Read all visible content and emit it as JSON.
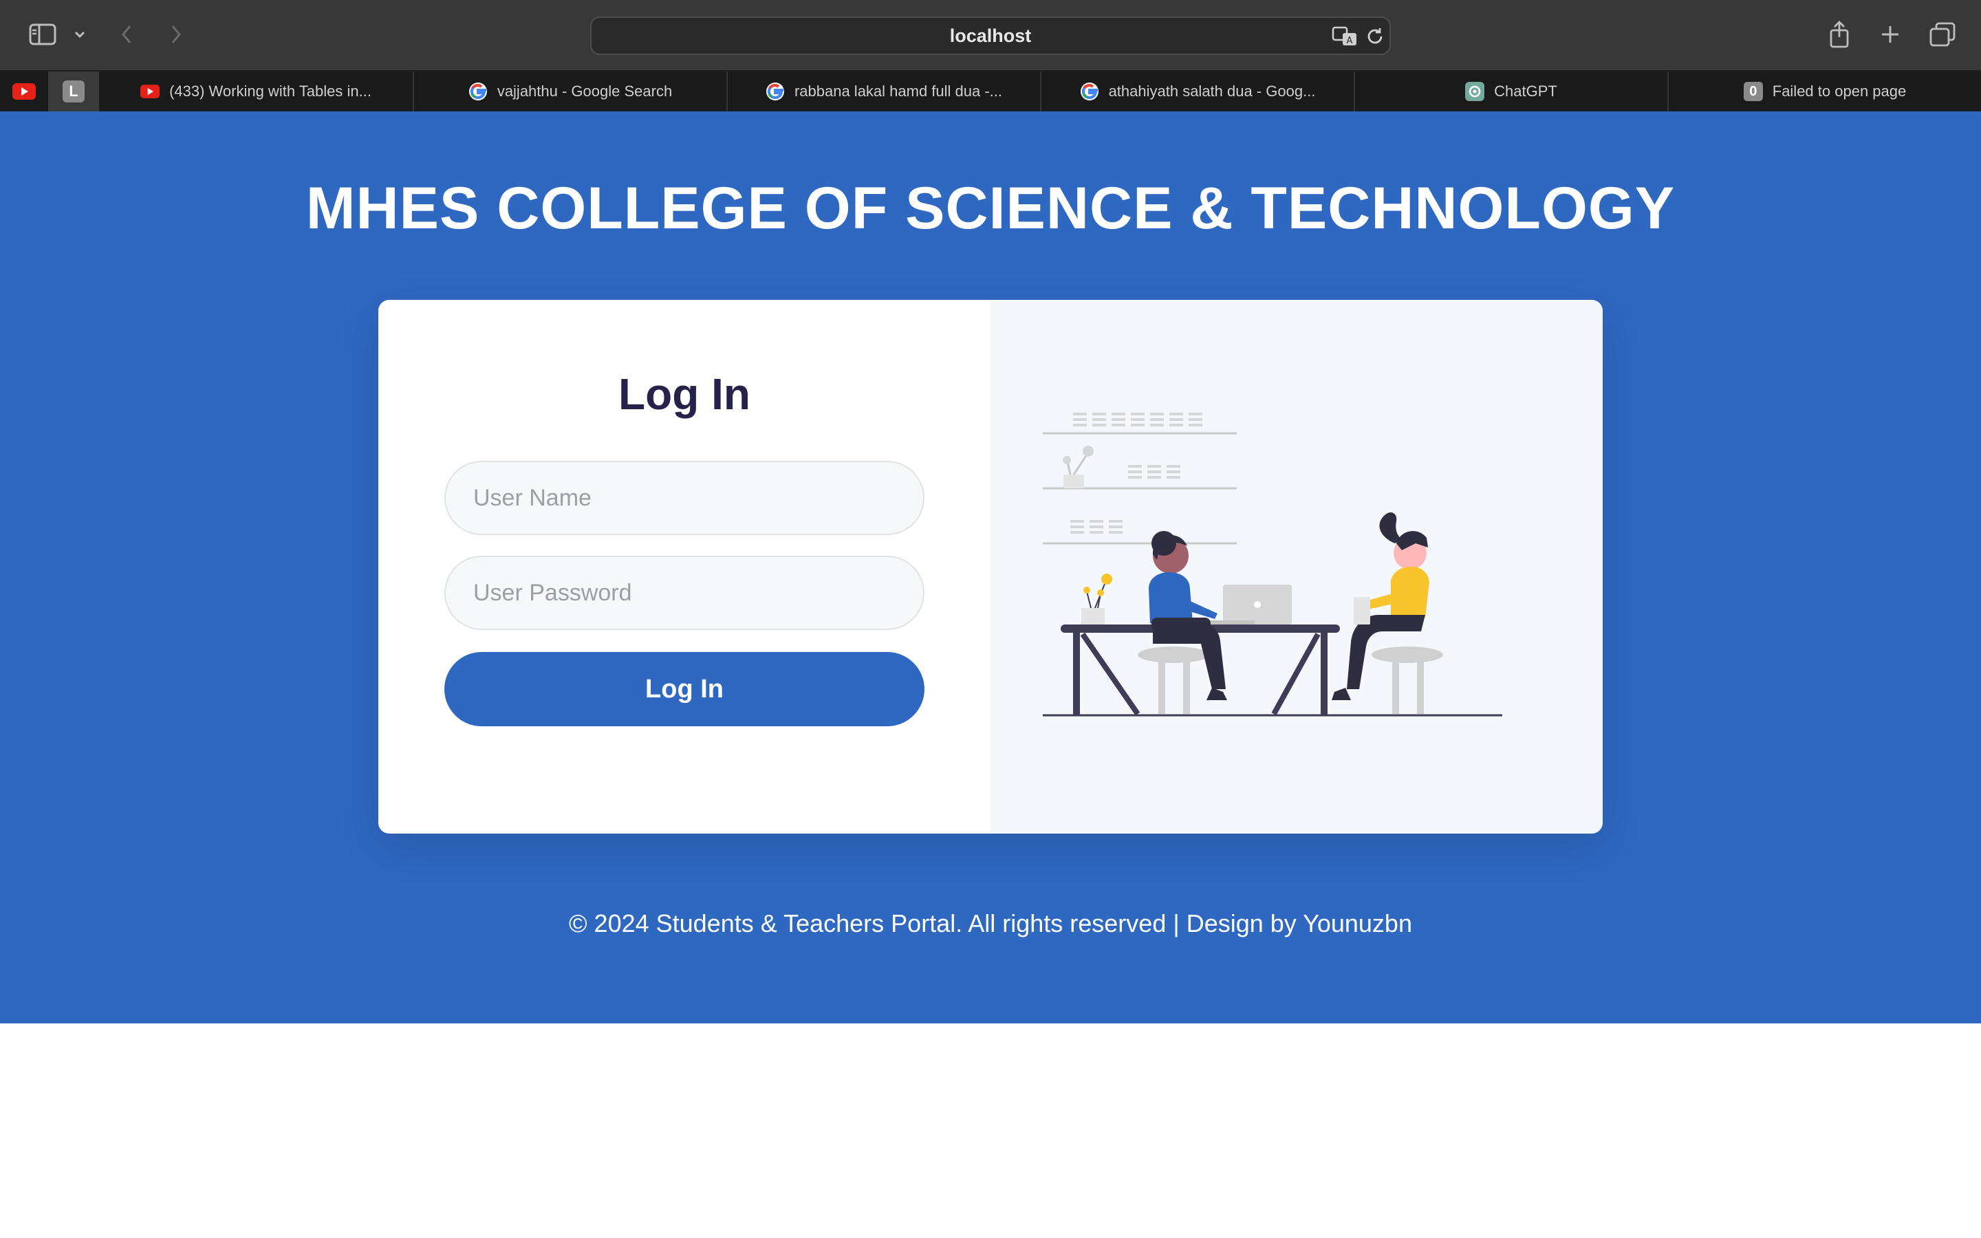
{
  "browser": {
    "url": "localhost",
    "tabs": [
      {
        "label": "(433) Working with Tables in...",
        "favicon": "youtube-icon"
      },
      {
        "label": "vajjahthu - Google Search",
        "favicon": "google-icon"
      },
      {
        "label": "rabbana lakal hamd full dua -...",
        "favicon": "google-icon"
      },
      {
        "label": "athahiyath salath dua - Goog...",
        "favicon": "google-icon"
      },
      {
        "label": "ChatGPT",
        "favicon": "chatgpt-icon"
      },
      {
        "label": "Failed to open page",
        "favicon": "zero-icon"
      }
    ],
    "pinned_tabs": [
      {
        "label": "",
        "favicon": "youtube-icon"
      },
      {
        "label": "L",
        "favicon": "letter-l-icon"
      }
    ],
    "zero_badge": "0"
  },
  "page": {
    "title": "MHES COLLEGE OF SCIENCE & TECHNOLOGY",
    "login": {
      "heading": "Log In",
      "username_placeholder": "User Name",
      "password_placeholder": "User Password",
      "button_label": "Log In"
    },
    "footer": "© 2024 Students & Teachers Portal. All rights reserved | Design by Younuzbn"
  },
  "colors": {
    "brand": "#2f68c0",
    "heading": "#25234a",
    "accent_yellow": "#f7c52b"
  }
}
